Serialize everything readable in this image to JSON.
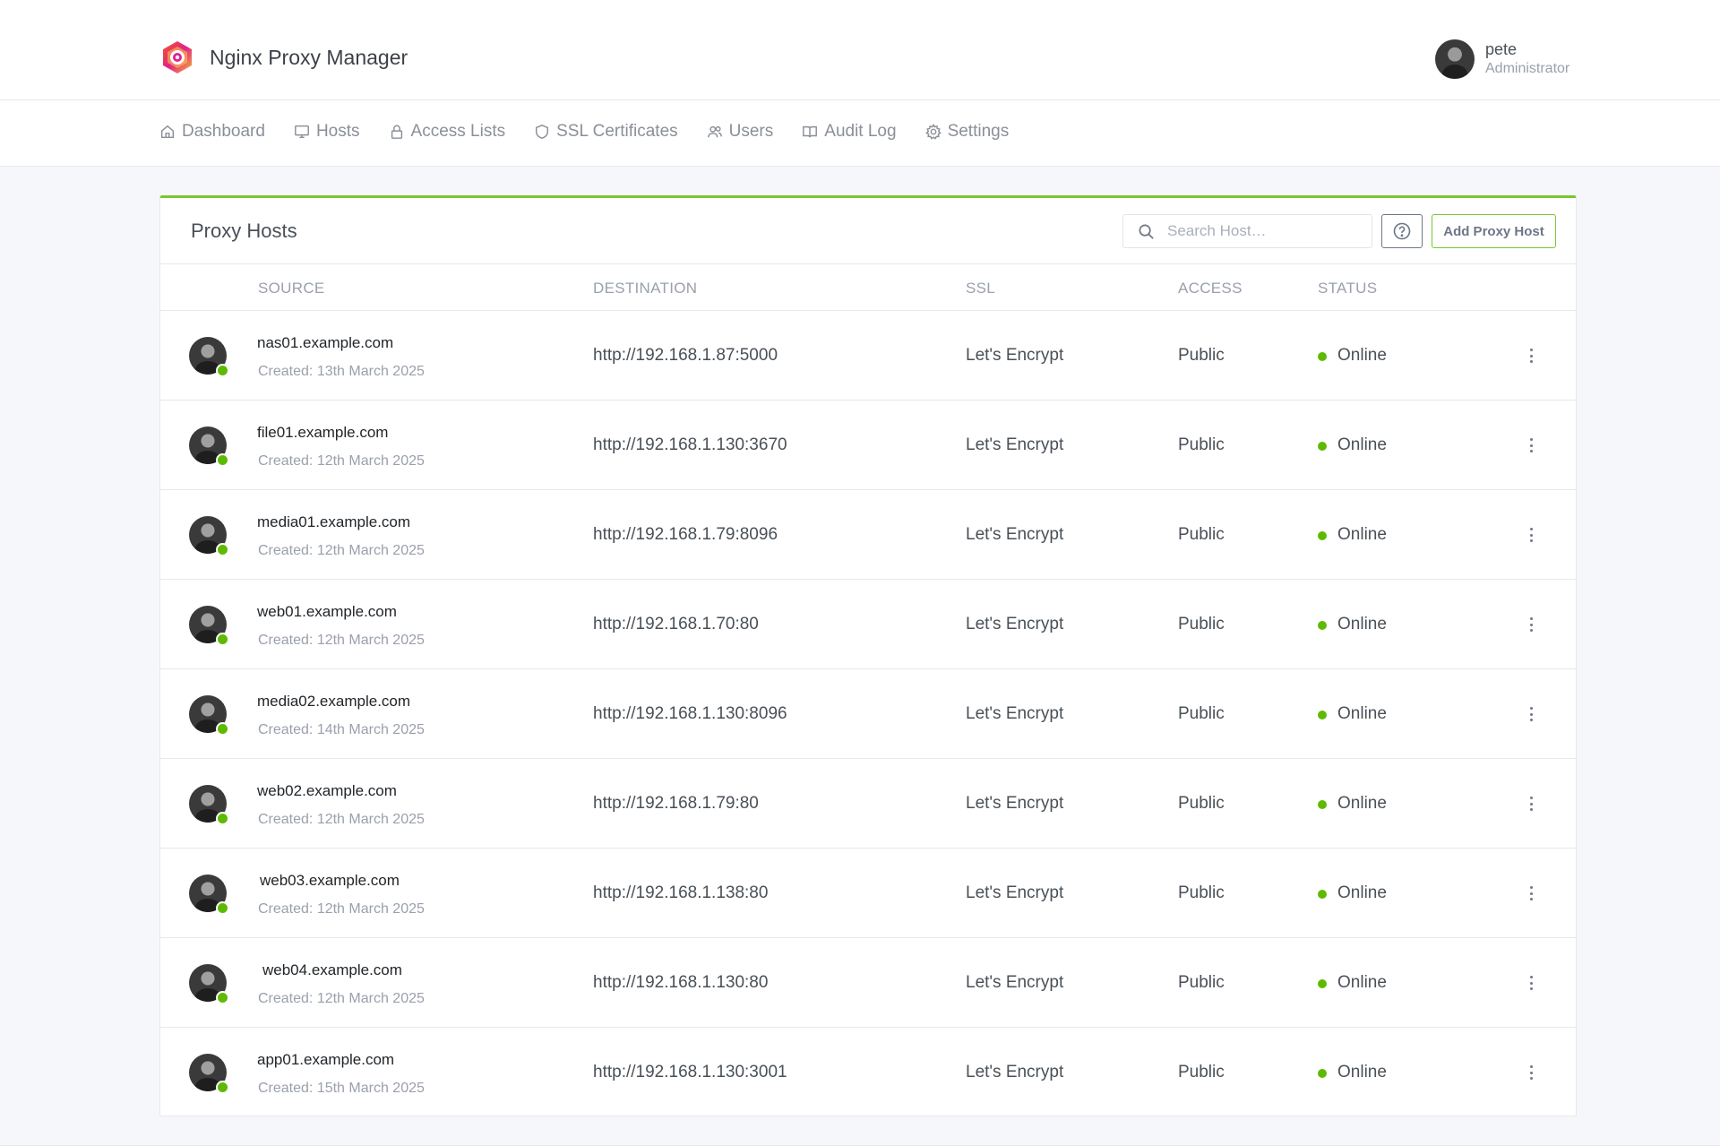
{
  "app": {
    "title": "Nginx Proxy Manager",
    "logo_icon": "nginx-proxy-manager-logo",
    "accent_color": "#7bc62d",
    "online_color": "#5eba00"
  },
  "user": {
    "name": "pete",
    "role": "Administrator"
  },
  "nav": {
    "items": [
      {
        "label": "Dashboard",
        "icon": "home-icon"
      },
      {
        "label": "Hosts",
        "icon": "monitor-icon"
      },
      {
        "label": "Access Lists",
        "icon": "lock-icon"
      },
      {
        "label": "SSL Certificates",
        "icon": "shield-icon"
      },
      {
        "label": "Users",
        "icon": "users-icon"
      },
      {
        "label": "Audit Log",
        "icon": "book-icon"
      },
      {
        "label": "Settings",
        "icon": "gear-icon"
      }
    ]
  },
  "card": {
    "title": "Proxy Hosts",
    "search_placeholder": "Search Host…",
    "add_button": "Add Proxy Host"
  },
  "table": {
    "columns": [
      "SOURCE",
      "DESTINATION",
      "SSL",
      "ACCESS",
      "STATUS"
    ],
    "rows": [
      {
        "source": "nas01.example.com",
        "created": "Created: 13th March 2025",
        "destination": "http://192.168.1.87:5000",
        "ssl": "Let's Encrypt",
        "access": "Public",
        "status": "Online"
      },
      {
        "source": "file01.example.com",
        "created": "Created: 12th March 2025",
        "destination": "http://192.168.1.130:3670",
        "ssl": "Let's Encrypt",
        "access": "Public",
        "status": "Online"
      },
      {
        "source": "media01.example.com",
        "created": "Created: 12th March 2025",
        "destination": "http://192.168.1.79:8096",
        "ssl": "Let's Encrypt",
        "access": "Public",
        "status": "Online"
      },
      {
        "source": "web01.example.com",
        "created": "Created: 12th March 2025",
        "destination": "http://192.168.1.70:80",
        "ssl": "Let's Encrypt",
        "access": "Public",
        "status": "Online"
      },
      {
        "source": "media02.example.com",
        "created": "Created: 14th March 2025",
        "destination": "http://192.168.1.130:8096",
        "ssl": "Let's Encrypt",
        "access": "Public",
        "status": "Online"
      },
      {
        "source": "web02.example.com",
        "created": "Created: 12th March 2025",
        "destination": "http://192.168.1.79:80",
        "ssl": "Let's Encrypt",
        "access": "Public",
        "status": "Online"
      },
      {
        "source": "web03.example.com",
        "created": "Created: 12th March 2025",
        "destination": "http://192.168.1.138:80",
        "ssl": "Let's Encrypt",
        "access": "Public",
        "status": "Online"
      },
      {
        "source": "web04.example.com",
        "created": "Created: 12th March 2025",
        "destination": "http://192.168.1.130:80",
        "ssl": "Let's Encrypt",
        "access": "Public",
        "status": "Online"
      },
      {
        "source": "app01.example.com",
        "created": "Created: 15th March 2025",
        "destination": "http://192.168.1.130:3001",
        "ssl": "Let's Encrypt",
        "access": "Public",
        "status": "Online"
      }
    ]
  }
}
